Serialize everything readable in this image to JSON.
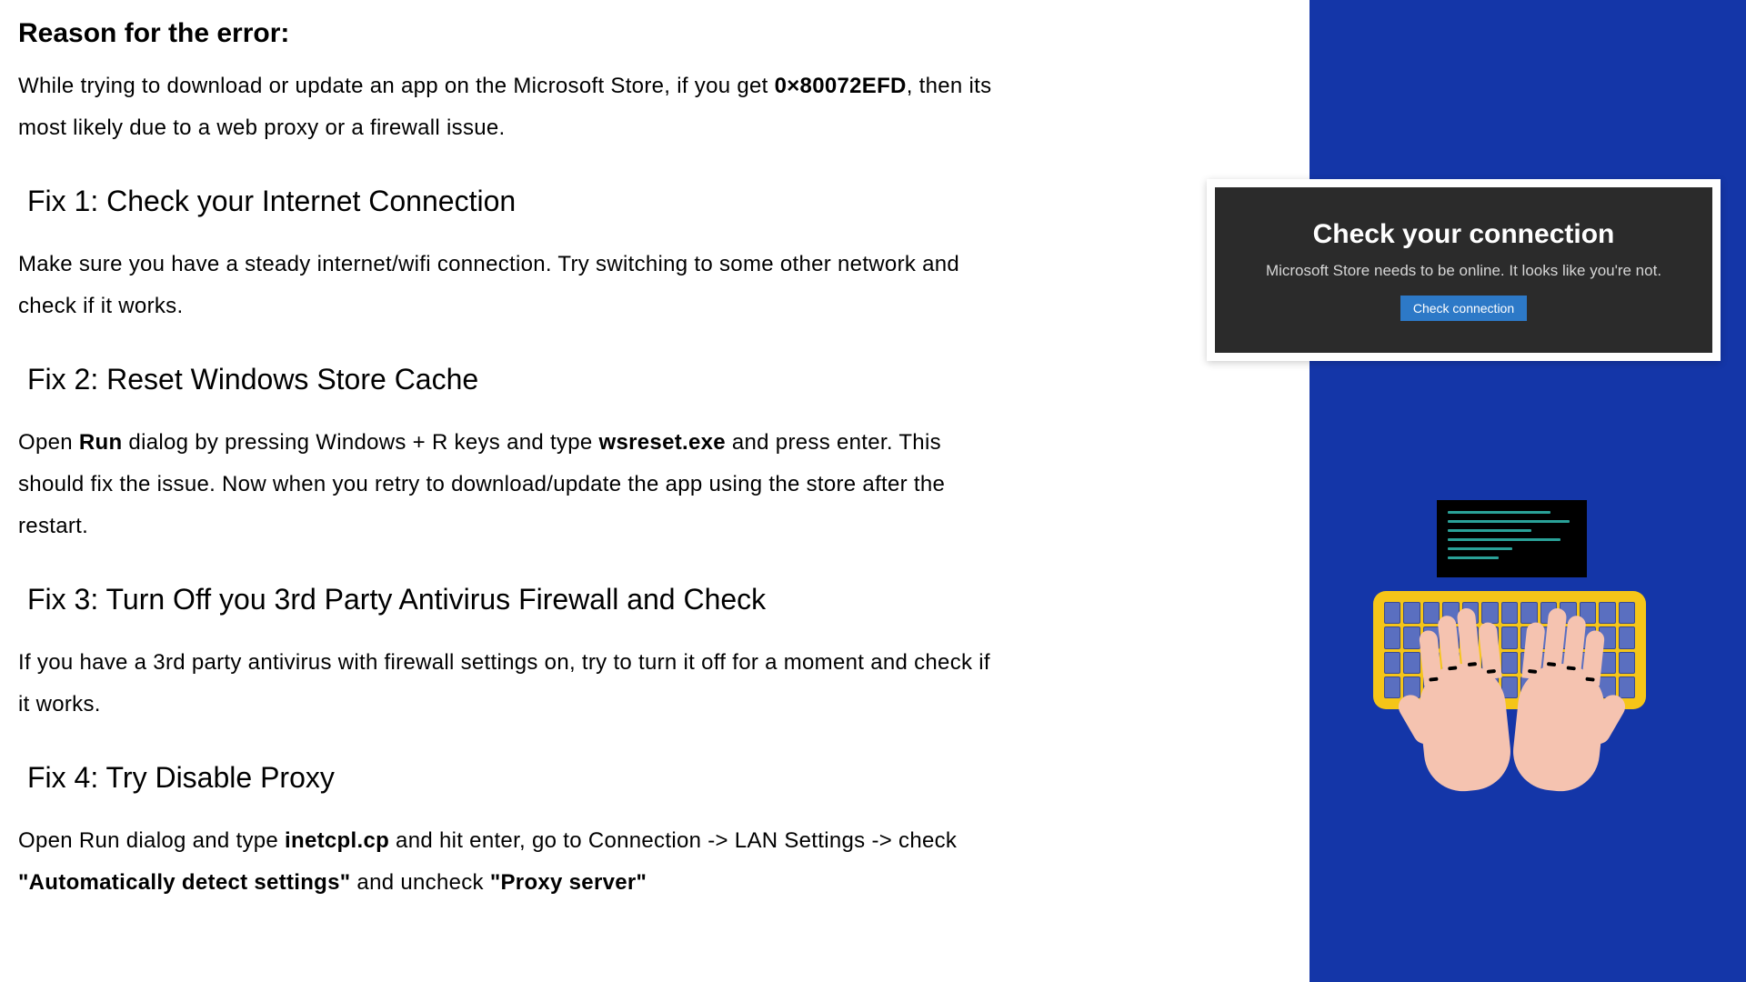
{
  "reason": {
    "heading": "Reason for the error:",
    "text_before": "While trying to download or update an app on the Microsoft Store, if you get ",
    "error_code": "0×80072EFD",
    "text_after": ", then its most likely due to a web proxy or a firewall issue."
  },
  "fixes": [
    {
      "heading": "Fix 1: Check your Internet Connection",
      "parts": [
        {
          "t": "Make sure you have a steady internet/wifi connection. Try switching to some other network and check if it works.",
          "b": false
        }
      ]
    },
    {
      "heading": "Fix 2: Reset Windows Store Cache",
      "parts": [
        {
          "t": "Open ",
          "b": false
        },
        {
          "t": "Run",
          "b": true
        },
        {
          "t": " dialog by pressing Windows + R keys and type ",
          "b": false
        },
        {
          "t": "wsreset.exe",
          "b": true
        },
        {
          "t": " and press enter. This should fix the issue. Now when you retry to download/update the app using the store after the restart.",
          "b": false
        }
      ]
    },
    {
      "heading": "Fix 3: Turn Off you 3rd Party Antivirus Firewall and Check",
      "parts": [
        {
          "t": "If you have a 3rd party antivirus with firewall settings on, try to turn it off for a moment and check if it works.",
          "b": false
        }
      ]
    },
    {
      "heading": "Fix 4: Try Disable Proxy",
      "parts": [
        {
          "t": "Open Run dialog and type ",
          "b": false
        },
        {
          "t": "inetcpl.cp",
          "b": true
        },
        {
          "t": " and hit enter, go to Connection -> LAN Settings -> check ",
          "b": false
        },
        {
          "t": "\"Automatically detect settings\"",
          "b": true
        },
        {
          "t": " and uncheck ",
          "b": false
        },
        {
          "t": "\"Proxy server\"",
          "b": true
        }
      ]
    }
  ],
  "card": {
    "title": "Check your connection",
    "subtitle": "Microsoft Store needs to be online. It looks like you're not.",
    "button": "Check connection"
  }
}
